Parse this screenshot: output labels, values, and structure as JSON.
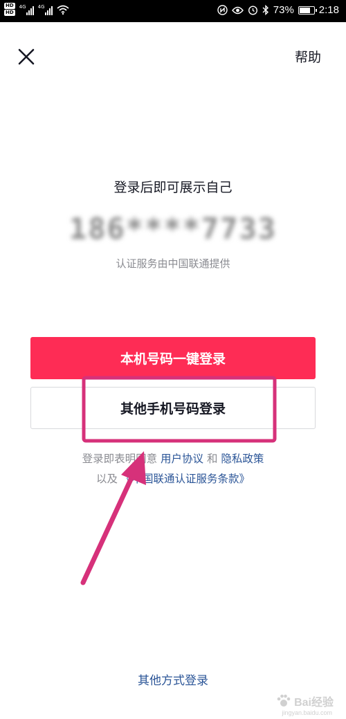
{
  "status_bar": {
    "hd_badge": "HD",
    "network_1": "4G",
    "network_2": "4G",
    "battery_level": 73,
    "battery_text": "73%",
    "time": "2:18",
    "icons": [
      "hd-icon",
      "signal-icon",
      "wifi-icon",
      "nfc-icon",
      "eye-icon",
      "alarm-icon",
      "bluetooth-icon",
      "battery-icon"
    ]
  },
  "header": {
    "close_icon": "close-icon",
    "help_label": "帮助"
  },
  "main": {
    "tagline": "登录后即可展示自己",
    "phone_number": "186****7733",
    "auth_provider": "认证服务由中国联通提供",
    "primary_button": "本机号码一键登录",
    "secondary_button": "其他手机号码登录"
  },
  "terms": {
    "line1_prefix": "登录即表明同意",
    "user_agreement": "用户协议",
    "and": "和",
    "privacy_policy": "隐私政策",
    "line2_prefix": "以及",
    "unicom_terms": "《中国联通认证服务条款》"
  },
  "footer": {
    "other_login": "其他方式登录"
  },
  "watermark": {
    "text": "Bai经验",
    "sub": "jingyan.baidu.com"
  },
  "colors": {
    "primary": "#fe2c55",
    "link": "#2b5597",
    "annotation": "#d6317a"
  }
}
